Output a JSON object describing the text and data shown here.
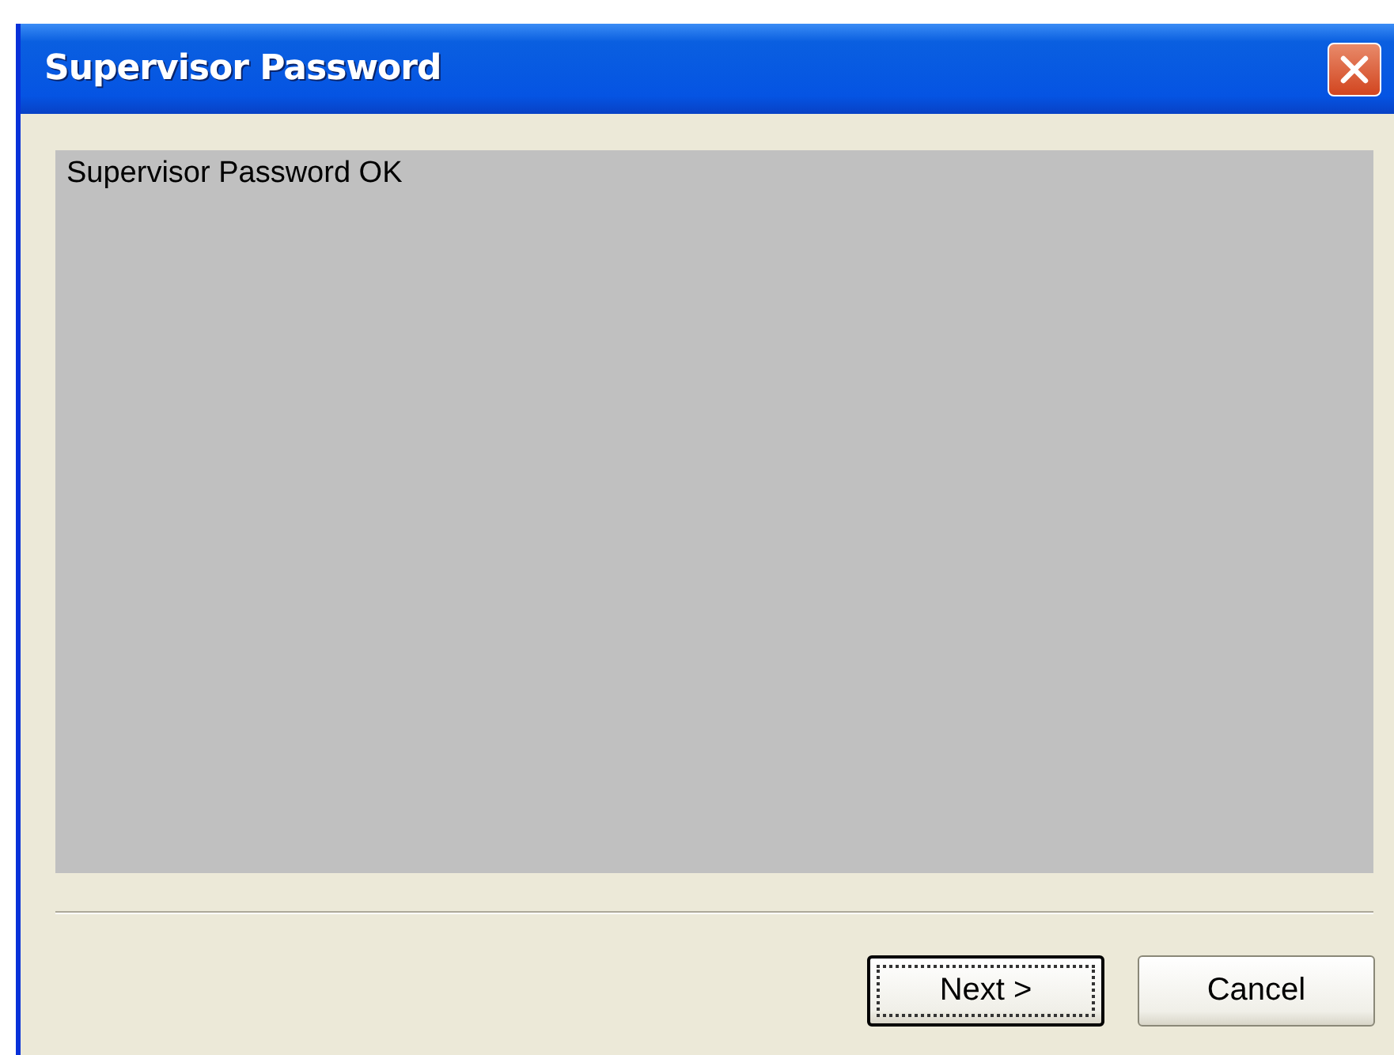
{
  "window": {
    "title": "Supervisor Password"
  },
  "message": "Supervisor Password OK",
  "buttons": [
    {
      "label": "Next >",
      "default": true
    },
    {
      "label": "Cancel",
      "default": false
    }
  ]
}
